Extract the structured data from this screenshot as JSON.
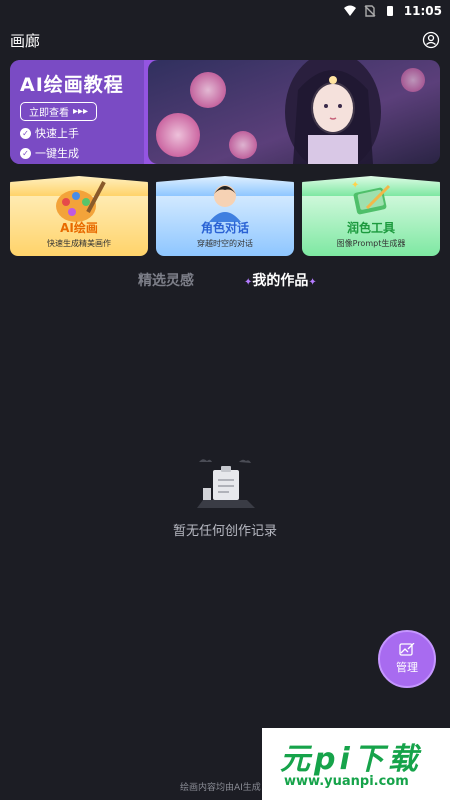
{
  "status_bar": {
    "time": "11:05"
  },
  "header": {
    "title": "画廊"
  },
  "banner": {
    "title": "AI绘画教程",
    "button_label": "立即查看",
    "checks": [
      "快速上手",
      "一键生成"
    ]
  },
  "cards": [
    {
      "title": "AI绘画",
      "subtitle": "快速生成精美画作"
    },
    {
      "title": "角色对话",
      "subtitle": "穿越时空的对话"
    },
    {
      "title": "润色工具",
      "subtitle": "图像Prompt生成器"
    }
  ],
  "tabs": {
    "inspire": "精选灵感",
    "mine": "我的作品"
  },
  "empty_state": {
    "text": "暂无任何创作记录"
  },
  "fab": {
    "label": "管理"
  },
  "footer": {
    "text": "绘画内容均由AI生成"
  },
  "watermark": {
    "title": "元pi下载",
    "url": "www.yuanpi.com"
  },
  "colors": {
    "background": "#1c1d24",
    "accent": "#a86bf0"
  }
}
